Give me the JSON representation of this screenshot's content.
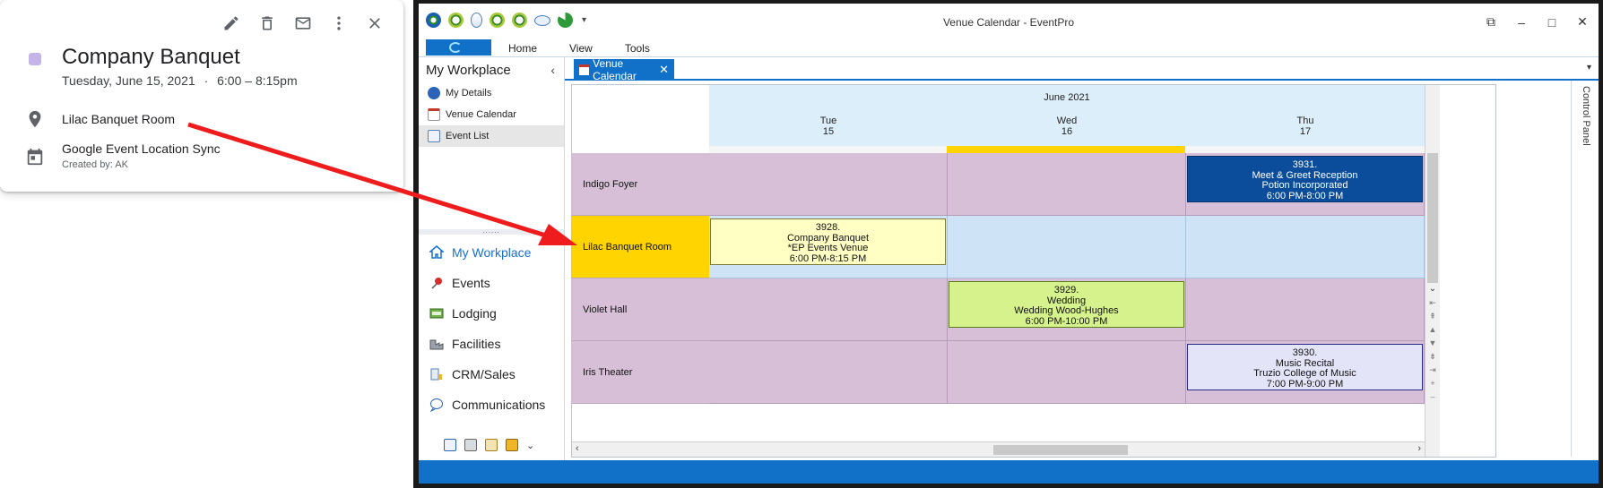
{
  "google_card": {
    "title": "Company Banquet",
    "date": "Tuesday, June 15, 2021",
    "separator": "·",
    "time": "6:00 – 8:15pm",
    "location": "Lilac Banquet Room",
    "calendar": "Google Event Location Sync",
    "created_by": "Created by: AK",
    "swatch_color": "#c5b4e8",
    "icons": [
      "edit-icon",
      "delete-icon",
      "email-icon",
      "more-vert-icon",
      "close-icon",
      "location-pin-icon",
      "calendar-icon"
    ]
  },
  "window": {
    "title": "Venue Calendar - EventPro",
    "menu": [
      "Home",
      "View",
      "Tools"
    ],
    "accent": "#1170c8",
    "controls": [
      "restore-icon",
      "minimize-icon",
      "maximize-icon",
      "close-icon"
    ]
  },
  "sidebar": {
    "header": "My Workplace",
    "items": [
      "My Details",
      "Venue Calendar",
      "Event List"
    ],
    "grip": "......",
    "nav": [
      "My Workplace",
      "Events",
      "Lodging",
      "Facilities",
      "CRM/Sales",
      "Communications"
    ],
    "nav_active": "My Workplace"
  },
  "tab": {
    "label": "Venue Calendar",
    "close": "✕"
  },
  "calendar": {
    "month": "June 2021",
    "days": [
      {
        "dow": "Tue",
        "num": "15"
      },
      {
        "dow": "Wed",
        "num": "16"
      },
      {
        "dow": "Thu",
        "num": "17"
      }
    ],
    "today_index": 1,
    "rooms": [
      "Indigo Foyer",
      "Lilac Banquet Room",
      "Violet Hall",
      "Iris Theater"
    ],
    "selected_room": "Lilac Banquet Room",
    "events": [
      {
        "room": 0,
        "day": 2,
        "style": "blue",
        "id": "3931.",
        "name": "Meet & Greet Reception",
        "client": "Potion Incorporated",
        "time": "6:00 PM-8:00 PM"
      },
      {
        "room": 1,
        "day": 0,
        "style": "yellow",
        "id": "3928.",
        "name": "Company Banquet",
        "client": "*EP Events Venue",
        "time": "6:00 PM-8:15 PM"
      },
      {
        "room": 2,
        "day": 1,
        "style": "green",
        "id": "3929.",
        "name": "Wedding",
        "client": "Wedding Wood-Hughes",
        "time": "6:00 PM-10:00 PM"
      },
      {
        "room": 3,
        "day": 2,
        "style": "lav",
        "id": "3930.",
        "name": "Music Recital",
        "client": "Truzio College of Music",
        "time": "7:00 PM-9:00 PM"
      }
    ]
  },
  "control_panel": "Control Panel",
  "annotation": {
    "arrow_color": "#ee1c1c"
  }
}
